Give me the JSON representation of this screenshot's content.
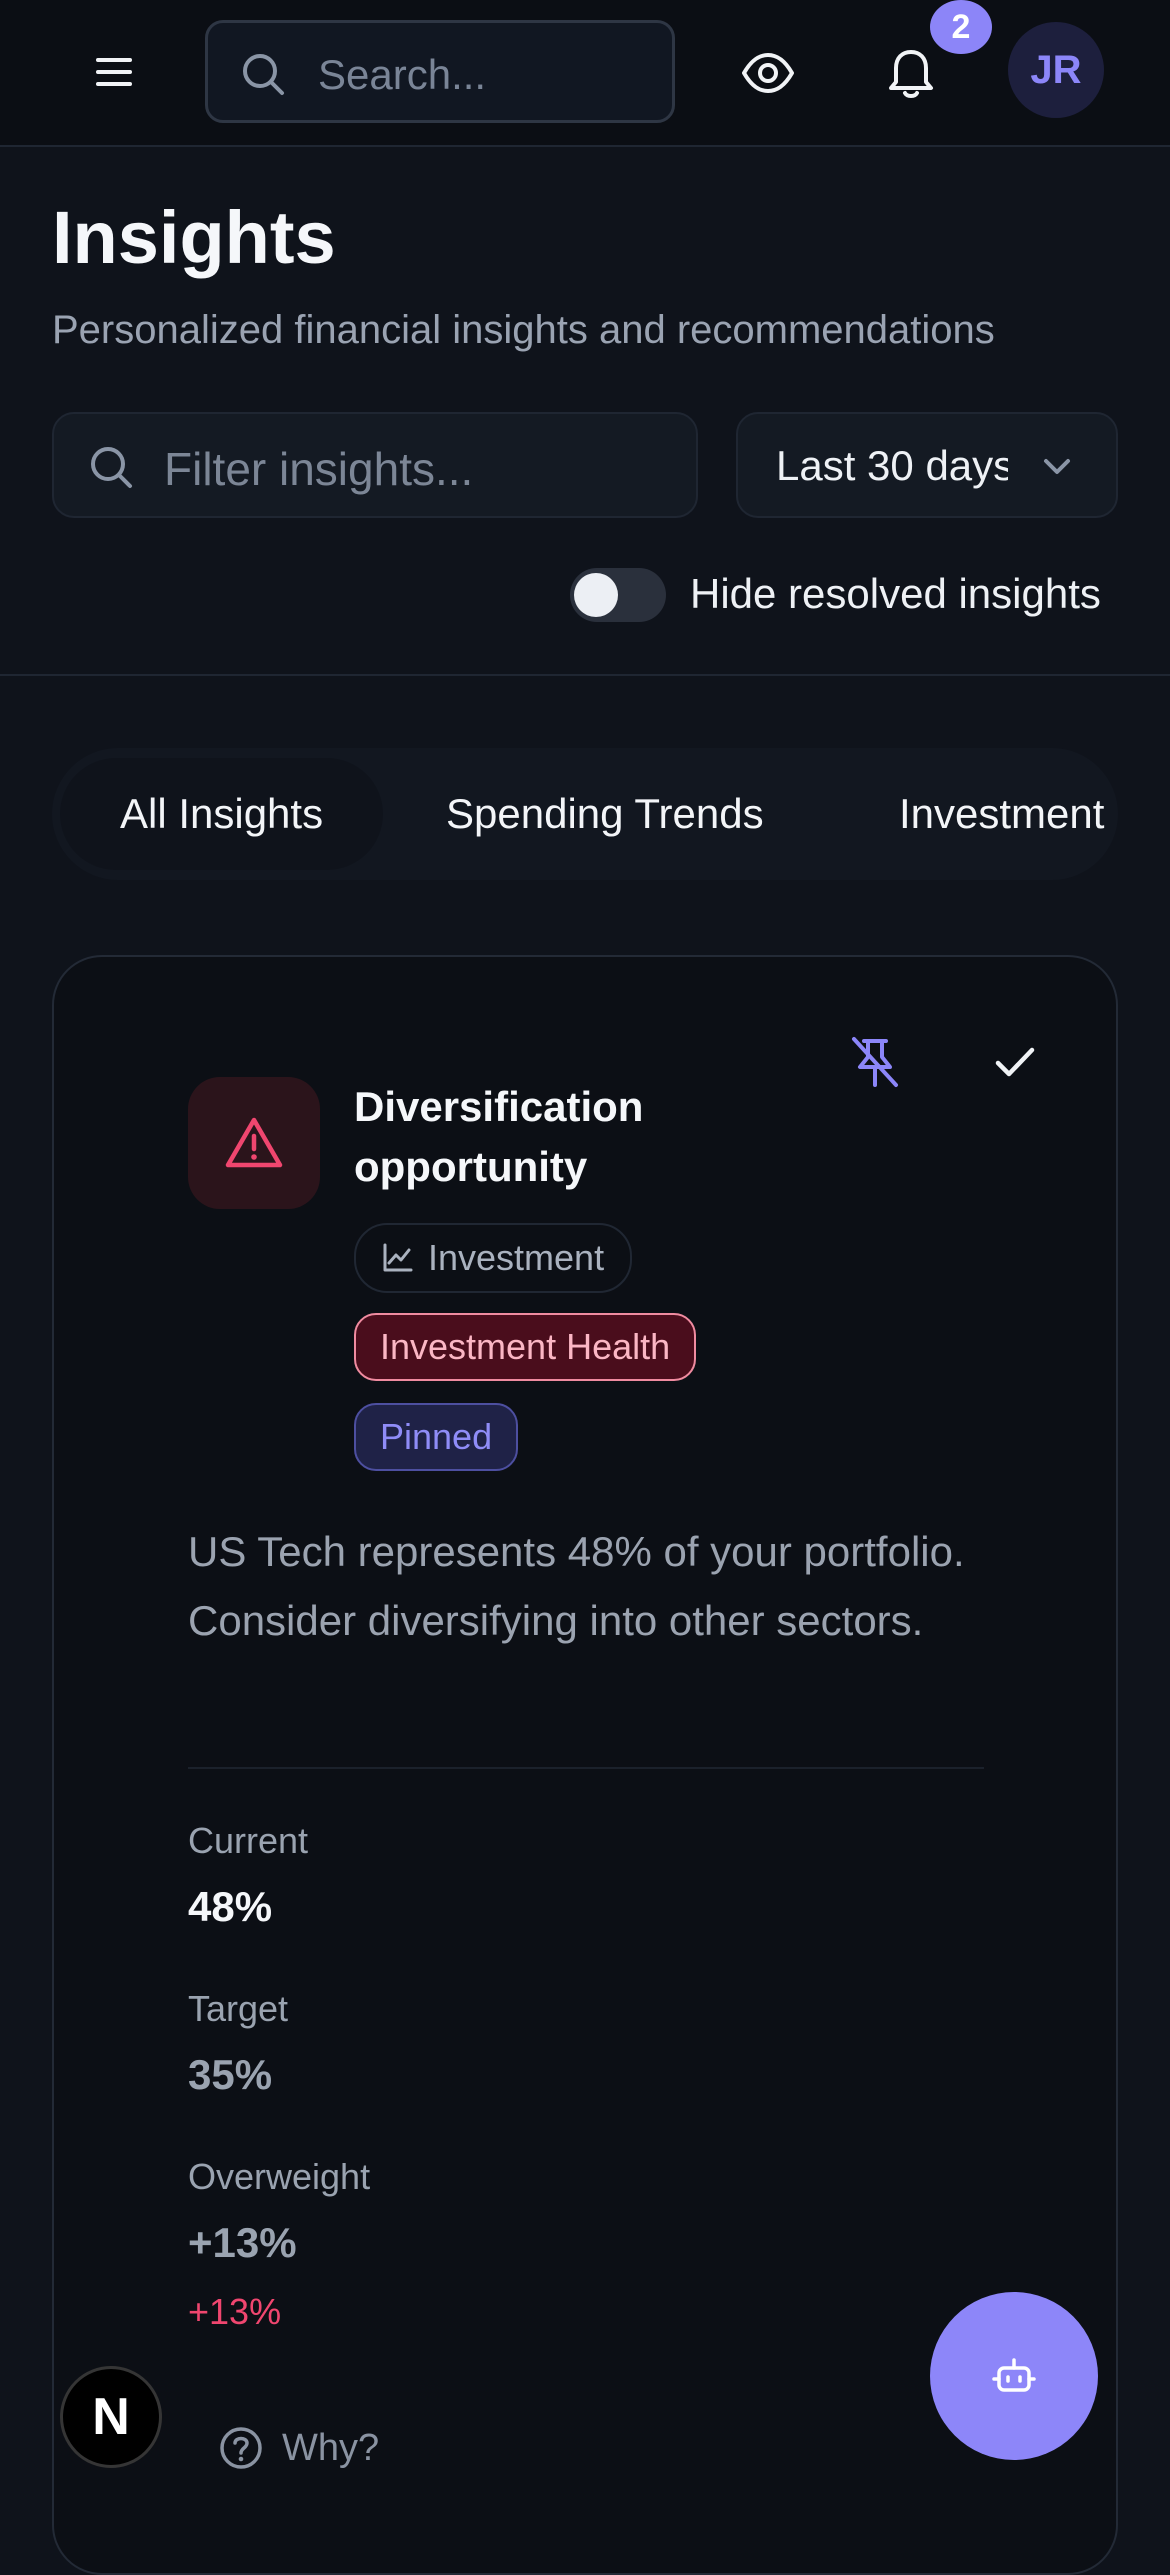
{
  "header": {
    "search_placeholder": "Search...",
    "notification_count": "2",
    "avatar_initials": "JR"
  },
  "page": {
    "title": "Insights",
    "subtitle": "Personalized financial insights and recommendations"
  },
  "filters": {
    "search_placeholder": "Filter insights...",
    "date_range": "Last 30 days",
    "hide_resolved_label": "Hide resolved insights",
    "hide_resolved_on": false
  },
  "tabs": [
    {
      "label": "All Insights",
      "active": true
    },
    {
      "label": "Spending Trends",
      "active": false
    },
    {
      "label": "Investment",
      "active": false
    }
  ],
  "insight": {
    "title": "Diversification opportunity",
    "category": "Investment",
    "tag": "Investment Health",
    "status": "Pinned",
    "description": "US Tech represents 48% of your portfolio. Consider diversifying into other sectors.",
    "metrics": {
      "current_label": "Current",
      "current_value": "48%",
      "target_label": "Target",
      "target_value": "35%",
      "overweight_label": "Overweight",
      "overweight_value": "+13%",
      "overweight_delta": "+13%"
    },
    "why_label": "Why?"
  },
  "dev_badge": "N",
  "colors": {
    "background": "#0f131b",
    "accent": "#8d86f9",
    "danger": "#f0466f",
    "danger_bg": "#4a0d1c"
  },
  "icons": {
    "menu": "menu-icon",
    "search": "search-icon",
    "eye": "eye-icon",
    "bell": "bell-icon",
    "unpin": "pin-off-icon",
    "resolve": "check-icon",
    "alert": "alert-triangle-icon",
    "category": "line-chart-icon",
    "why": "help-circle-icon",
    "assistant": "bot-icon"
  }
}
